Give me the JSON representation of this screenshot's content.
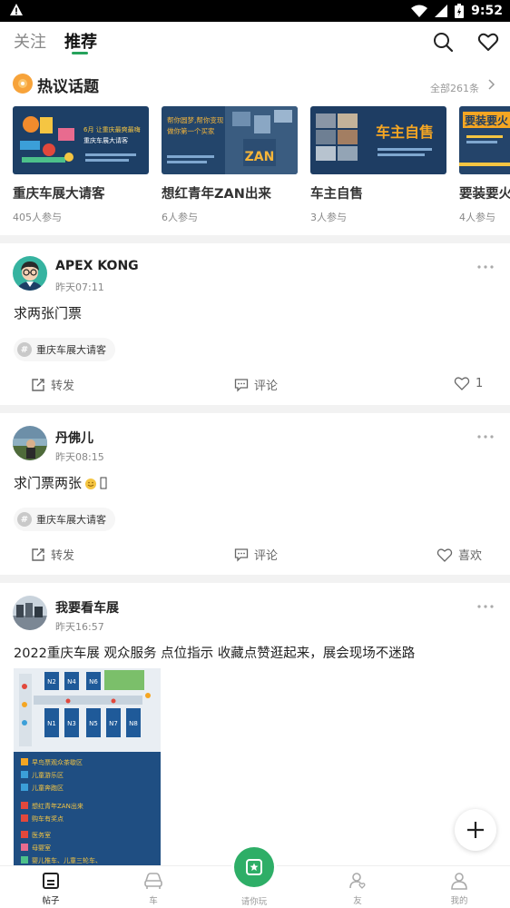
{
  "status_bar": {
    "time": "9:52"
  },
  "tabs": [
    {
      "label": "关注",
      "active": false
    },
    {
      "label": "推荐",
      "active": true
    }
  ],
  "hot_topics": {
    "title": "热议话题",
    "all_label": "全部261条",
    "items": [
      {
        "name": "重庆车展大请客",
        "participants": "405人参与",
        "banner_text": "6月 让重庆最爽最嗨 重庆车展大请客"
      },
      {
        "name": "想红青年ZAN出来",
        "participants": "6人参与",
        "banner_text": "帮你圆梦,帮你变现 做你第一个买家"
      },
      {
        "name": "车主自售",
        "participants": "3人参与",
        "banner_text": "车主自售"
      },
      {
        "name": "要装要火",
        "participants": "4人参与",
        "banner_text": "要装要火"
      }
    ]
  },
  "posts": [
    {
      "author": "APEX  KONG",
      "time": "昨天07:11",
      "text": "求两张门票",
      "tag": "重庆车展大请客",
      "share_label": "转发",
      "comment_label": "评论",
      "like_label": "1"
    },
    {
      "author": "丹佛儿",
      "time": "昨天08:15",
      "text": "求门票两张",
      "tag": "重庆车展大请客",
      "share_label": "转发",
      "comment_label": "评论",
      "like_label": "喜欢"
    },
    {
      "author": "我要看车展",
      "time": "昨天16:57",
      "text": "2022重庆车展 观众服务 点位指示 收藏点赞逛起来，展会现场不迷路",
      "map_halls": [
        "N2",
        "N4",
        "N6",
        "N1",
        "N3",
        "N5",
        "N7",
        "N8"
      ],
      "map_legend": [
        "早鸟票观众茶歇区",
        "儿童游乐区",
        "儿童奔跑区",
        "想红青年ZAN出来",
        "购车有奖点",
        "医务室",
        "母婴室",
        "婴儿推车、儿童三轮车、"
      ]
    }
  ],
  "bottom_nav": [
    {
      "label": "帖子",
      "active": true
    },
    {
      "label": "车",
      "active": false
    },
    {
      "label": "请你玩",
      "active": false
    },
    {
      "label": "友",
      "active": false
    },
    {
      "label": "我的",
      "active": false
    }
  ],
  "colors": {
    "accent": "#2eae67",
    "tab_underline": "#26a25b",
    "divider": "#f2f2f2"
  }
}
